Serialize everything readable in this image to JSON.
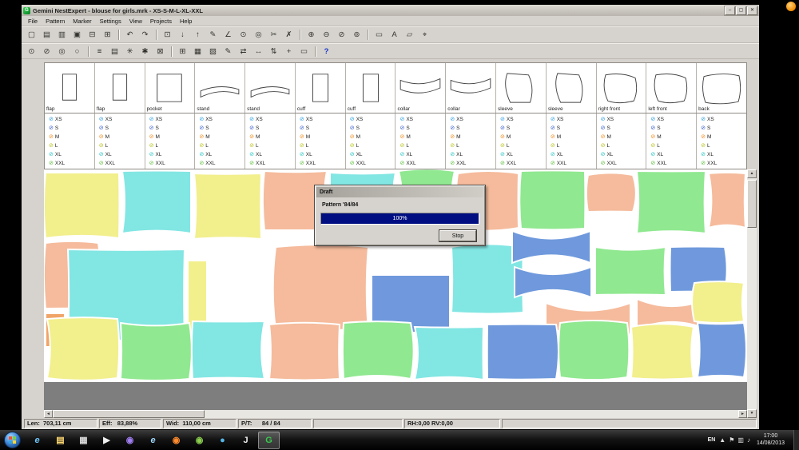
{
  "window": {
    "title": "Gemini NestExpert - blouse for girls.mrk - XS-S-M-L-XL-XXL",
    "buttons": [
      {
        "n": "minimize-button",
        "g": "–"
      },
      {
        "n": "maximize-button",
        "g": "▢"
      },
      {
        "n": "close-button",
        "g": "✕"
      }
    ]
  },
  "menu": [
    "File",
    "Pattern",
    "Marker",
    "Settings",
    "View",
    "Projects",
    "Help"
  ],
  "toolbar1": [
    {
      "g": "▢",
      "n": "new-marker"
    },
    {
      "g": "▤",
      "n": "open"
    },
    {
      "g": "▥",
      "n": "import"
    },
    {
      "g": "▣",
      "n": "save"
    },
    {
      "g": "⊟",
      "n": "print"
    },
    {
      "g": "⊞",
      "n": "table"
    },
    {
      "sep": true
    },
    {
      "g": "↶",
      "n": "undo"
    },
    {
      "g": "↷",
      "n": "redo"
    },
    {
      "sep": true
    },
    {
      "g": "⊡",
      "n": "select-tool"
    },
    {
      "g": "↓",
      "n": "move-down"
    },
    {
      "g": "↑",
      "n": "move-up"
    },
    {
      "g": "✎",
      "n": "draw-tool"
    },
    {
      "g": "∠",
      "n": "angle-tool"
    },
    {
      "g": "⊙",
      "n": "point-tool"
    },
    {
      "g": "◎",
      "n": "rotate-tool"
    },
    {
      "g": "✂",
      "n": "cut-tool"
    },
    {
      "g": "✗",
      "n": "delete-tool"
    },
    {
      "sep": true
    },
    {
      "g": "⊕",
      "n": "zoom-in"
    },
    {
      "g": "⊖",
      "n": "zoom-out"
    },
    {
      "g": "⊘",
      "n": "zoom-window"
    },
    {
      "g": "⊚",
      "n": "zoom-fit"
    },
    {
      "sep": true
    },
    {
      "g": "▭",
      "n": "measure-tool"
    },
    {
      "g": "A",
      "n": "text-tool"
    },
    {
      "g": "▱",
      "n": "shape-tool"
    },
    {
      "g": "⌖",
      "n": "reference-tool"
    }
  ],
  "toolbar2": [
    {
      "g": "⊙",
      "n": "zoom-selection"
    },
    {
      "g": "⊘",
      "n": "zoom-previous"
    },
    {
      "g": "◎",
      "n": "zoom-all"
    },
    {
      "g": "○",
      "n": "zoom-marker"
    },
    {
      "sep": true
    },
    {
      "g": "≡",
      "n": "list-view"
    },
    {
      "g": "▤",
      "n": "report-view"
    },
    {
      "g": "✳",
      "n": "overlap-check"
    },
    {
      "g": "✱",
      "n": "auto-nest"
    },
    {
      "g": "⊠",
      "n": "lock-piece"
    },
    {
      "sep": true
    },
    {
      "g": "⊞",
      "n": "grid"
    },
    {
      "g": "▦",
      "n": "fabric-grid"
    },
    {
      "g": "▧",
      "n": "shading"
    },
    {
      "g": "✎",
      "n": "edit-piece"
    },
    {
      "g": "⇄",
      "n": "swap-pieces"
    },
    {
      "g": "↔",
      "n": "stretch"
    },
    {
      "g": "⇅",
      "n": "flip-vertical"
    },
    {
      "g": "+",
      "n": "add-point"
    },
    {
      "g": "▭",
      "n": "ruler"
    },
    {
      "sep": true
    },
    {
      "g": "?",
      "n": "context-help",
      "c": "#1535c8"
    }
  ],
  "sizes": [
    {
      "label": "XS",
      "color": "#2f9fe0"
    },
    {
      "label": "S",
      "color": "#3b5fd0"
    },
    {
      "label": "M",
      "color": "#f08c1e"
    },
    {
      "label": "L",
      "color": "#b9c21c"
    },
    {
      "label": "XL",
      "color": "#2cc3c3"
    },
    {
      "label": "XXL",
      "color": "#5fbf3f"
    }
  ],
  "patterns": [
    {
      "name": "flap",
      "shape": "flap"
    },
    {
      "name": "flap",
      "shape": "flap"
    },
    {
      "name": "pocket",
      "shape": "pocket"
    },
    {
      "name": "stand",
      "shape": "stand"
    },
    {
      "name": "stand",
      "shape": "stand"
    },
    {
      "name": "cuff",
      "shape": "cuff"
    },
    {
      "name": "cuff",
      "shape": "cuff"
    },
    {
      "name": "collar",
      "shape": "collar"
    },
    {
      "name": "collar",
      "shape": "collar"
    },
    {
      "name": "sleeve",
      "shape": "sleeve"
    },
    {
      "name": "sleeve",
      "shape": "sleeve"
    },
    {
      "name": "right front",
      "shape": "front"
    },
    {
      "name": "left front",
      "shape": "front"
    },
    {
      "name": "back",
      "shape": "back"
    }
  ],
  "canvas": {
    "palette": {
      "y": "#f2ef8d",
      "c": "#82e6e3",
      "s": "#f5bb9c",
      "g": "#90e890",
      "b": "#6f99dc",
      "o": "#f0a468"
    },
    "pieces": [
      [
        2,
        4,
        92,
        82,
        "y",
        "blob"
      ],
      [
        98,
        2,
        86,
        78,
        "c",
        "blob"
      ],
      [
        188,
        5,
        84,
        82,
        "y",
        "blob"
      ],
      [
        276,
        2,
        78,
        74,
        "s",
        "blob"
      ],
      [
        358,
        4,
        82,
        54,
        "c",
        "blob"
      ],
      [
        444,
        2,
        70,
        60,
        "g",
        "blob"
      ],
      [
        518,
        5,
        76,
        68,
        "s",
        "blob"
      ],
      [
        597,
        2,
        80,
        72,
        "g",
        "blob"
      ],
      [
        681,
        7,
        56,
        46,
        "s",
        "blob"
      ],
      [
        742,
        2,
        86,
        78,
        "g",
        "blob"
      ],
      [
        832,
        5,
        46,
        68,
        "s",
        "blob"
      ],
      [
        2,
        92,
        66,
        82,
        "s",
        "blob"
      ],
      [
        30,
        100,
        146,
        112,
        "c",
        "blob"
      ],
      [
        2,
        180,
        24,
        42,
        "o",
        "rect"
      ],
      [
        180,
        114,
        24,
        90,
        "y",
        "rect"
      ],
      [
        290,
        97,
        116,
        104,
        "s",
        "blob"
      ],
      [
        410,
        132,
        98,
        72,
        "b",
        "rect"
      ],
      [
        510,
        97,
        90,
        82,
        "c",
        "blob"
      ],
      [
        586,
        77,
        98,
        40,
        "b",
        "bowtie"
      ],
      [
        589,
        122,
        96,
        38,
        "b",
        "bowtie"
      ],
      [
        690,
        97,
        88,
        60,
        "g",
        "blob"
      ],
      [
        628,
        167,
        106,
        40,
        "s",
        "bowtie"
      ],
      [
        742,
        162,
        88,
        38,
        "s",
        "bowtie"
      ],
      [
        784,
        97,
        68,
        56,
        "b",
        "blob"
      ],
      [
        814,
        142,
        62,
        48,
        "y",
        "blob"
      ],
      [
        4,
        187,
        88,
        74,
        "y",
        "blob"
      ],
      [
        96,
        192,
        86,
        70,
        "g",
        "blob"
      ],
      [
        186,
        190,
        90,
        72,
        "c",
        "blob"
      ],
      [
        282,
        194,
        88,
        68,
        "s",
        "blob"
      ],
      [
        375,
        192,
        84,
        70,
        "g",
        "blob"
      ],
      [
        464,
        197,
        86,
        66,
        "c",
        "blob"
      ],
      [
        555,
        194,
        86,
        68,
        "b",
        "blob"
      ],
      [
        646,
        192,
        84,
        68,
        "g",
        "blob"
      ],
      [
        735,
        197,
        78,
        64,
        "y",
        "blob"
      ],
      [
        818,
        192,
        58,
        68,
        "b",
        "blob"
      ]
    ]
  },
  "dialog": {
    "title": "Draft",
    "label": "Pattern '84/84",
    "progress": "100%",
    "stop": "Stop"
  },
  "status": {
    "len": "Len:  703,11 cm",
    "eff": "Eff:   83,88%",
    "wid": "Wid:  110,00 cm",
    "pt": "P/T:      84 / 84",
    "rhrv": "RH:0,00 RV:0,00"
  },
  "taskbar": {
    "lang": "EN",
    "time": "17:00",
    "date": "14/08/2013",
    "icons": [
      {
        "n": "internet-explorer-icon",
        "g": "e",
        "c": "#6fc8ff",
        "italic": true
      },
      {
        "n": "file-explorer-icon",
        "g": "▤",
        "c": "#ffd973"
      },
      {
        "n": "media-library-icon",
        "g": "▦",
        "c": "#d8d8d8"
      },
      {
        "n": "video-player-icon",
        "g": "▶",
        "c": "#efefef"
      },
      {
        "n": "music-player-icon",
        "g": "◉",
        "c": "#a07ef0"
      },
      {
        "n": "browser-2-icon",
        "g": "e",
        "c": "#9fd8ff",
        "italic": true
      },
      {
        "n": "firefox-icon",
        "g": "◉",
        "c": "#ff8b2e"
      },
      {
        "n": "chrome-icon",
        "g": "◉",
        "c": "#8ccf4e"
      },
      {
        "n": "skype-icon",
        "g": "●",
        "c": "#56b6e8"
      },
      {
        "n": "java-app-icon",
        "g": "J",
        "c": "#f0f0f0"
      },
      {
        "n": "gemini-nestexpert-icon",
        "g": "G",
        "c": "#39c84e",
        "active": true
      }
    ],
    "tray_icons": [
      {
        "n": "hidden-icons-icon",
        "g": "▲"
      },
      {
        "n": "flag-icon",
        "g": "⚑"
      },
      {
        "n": "network-icon",
        "g": "▥"
      },
      {
        "n": "volume-icon",
        "g": "♪"
      }
    ]
  }
}
